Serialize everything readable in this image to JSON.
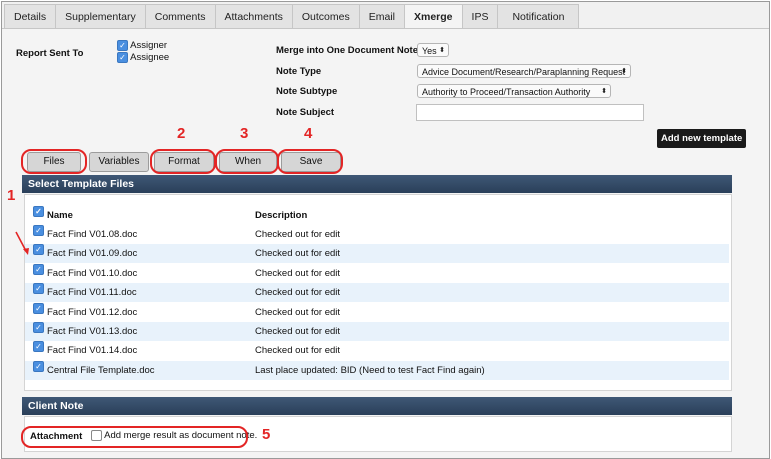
{
  "tabs": [
    "Details",
    "Supplementary",
    "Comments",
    "Attachments",
    "Outcomes",
    "Email",
    "Xmerge",
    "IPS",
    "Notification"
  ],
  "active_tab": "Xmerge",
  "report_sent_to": {
    "label": "Report Sent To",
    "assigner": "Assigner",
    "assignee": "Assignee"
  },
  "merge": {
    "merge_label": "Merge into One Document Note",
    "merge_value": "Yes",
    "note_type_label": "Note Type",
    "note_type_value": "Advice Document/Research/Paraplanning Request",
    "note_subtype_label": "Note Subtype",
    "note_subtype_value": "Authority to Proceed/Transaction Authority",
    "note_subject_label": "Note Subject",
    "note_subject_value": ""
  },
  "add_template_label": "Add new template",
  "buttons": {
    "files": "Files",
    "variables": "Variables",
    "format": "Format",
    "when": "When",
    "save": "Save"
  },
  "annotations": [
    "1",
    "2",
    "3",
    "4",
    "5"
  ],
  "annotation_color": "#e32525",
  "template_section": {
    "title": "Select Template Files",
    "col_name": "Name",
    "col_desc": "Description",
    "rows": [
      {
        "name": "Fact Find V01.08.doc",
        "desc": "Checked out for edit"
      },
      {
        "name": "Fact Find V01.09.doc",
        "desc": "Checked out for edit"
      },
      {
        "name": "Fact Find V01.10.doc",
        "desc": "Checked out for edit"
      },
      {
        "name": "Fact Find V01.11.doc",
        "desc": "Checked out for edit"
      },
      {
        "name": "Fact Find V01.12.doc",
        "desc": "Checked out for edit"
      },
      {
        "name": "Fact Find V01.13.doc",
        "desc": "Checked out for edit"
      },
      {
        "name": "Fact Find V01.14.doc",
        "desc": "Checked out for edit"
      },
      {
        "name": "Central File Template.doc",
        "desc": "Last place updated: BID (Need to test Fact Find again)"
      }
    ]
  },
  "client_note": {
    "title": "Client Note",
    "attachment_label": "Attachment",
    "checkbox_label": "Add merge result as document note."
  }
}
